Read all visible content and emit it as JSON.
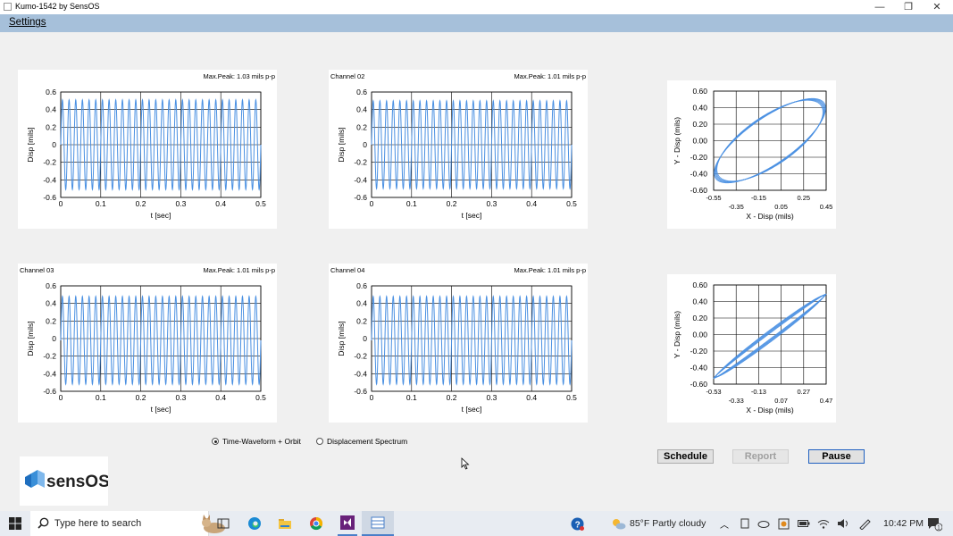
{
  "window": {
    "title": "Kumo-1542 by SensOS",
    "minimize": "—",
    "restore": "❐",
    "close": "✕"
  },
  "menu": {
    "settings": "Settings"
  },
  "charts": {
    "ch1": {
      "label": "",
      "peak": "Max.Peak: 1.03 mils p-p"
    },
    "ch2": {
      "label": "Channel 02",
      "peak": "Max.Peak: 1.01 mils p-p"
    },
    "ch3": {
      "label": "Channel 03",
      "peak": "Max.Peak: 1.01 mils p-p"
    },
    "ch4": {
      "label": "Channel 04",
      "peak": "Max.Peak: 1.01 mils p-p"
    }
  },
  "chart_data": [
    {
      "type": "line",
      "id": "ch1",
      "xlabel": "t [sec]",
      "ylabel": "Disp [mils]",
      "xlim": [
        0,
        0.5
      ],
      "ylim": [
        -0.6,
        0.6
      ],
      "xticks": [
        "0",
        "0.1",
        "0.2",
        "0.3",
        "0.4",
        "0.5"
      ],
      "yticks": [
        "0.6",
        "0.4",
        "0.2",
        "0",
        "-0.2",
        "-0.4",
        "-0.6"
      ],
      "grid": true,
      "series": [
        {
          "amplitude": 0.51,
          "offset": 0.0,
          "cycles": 30,
          "color": "#4a90e2"
        }
      ]
    },
    {
      "type": "line",
      "id": "ch2",
      "xlabel": "t [sec]",
      "ylabel": "Disp [mils]",
      "xlim": [
        0,
        0.5
      ],
      "ylim": [
        -0.6,
        0.6
      ],
      "xticks": [
        "0",
        "0.1",
        "0.2",
        "0.3",
        "0.4",
        "0.5"
      ],
      "yticks": [
        "0.6",
        "0.4",
        "0.2",
        "0",
        "-0.2",
        "-0.4",
        "-0.6"
      ],
      "grid": true,
      "series": [
        {
          "amplitude": 0.5,
          "offset": 0.0,
          "cycles": 30,
          "color": "#4a90e2"
        }
      ]
    },
    {
      "type": "line",
      "id": "ch3",
      "xlabel": "t [sec]",
      "ylabel": "Disp [mils]",
      "xlim": [
        0,
        0.5
      ],
      "ylim": [
        -0.6,
        0.6
      ],
      "xticks": [
        "0",
        "0.1",
        "0.2",
        "0.3",
        "0.4",
        "0.5"
      ],
      "yticks": [
        "0.6",
        "0.4",
        "0.2",
        "0",
        "-0.2",
        "-0.4",
        "-0.6"
      ],
      "grid": true,
      "series": [
        {
          "amplitude": 0.5,
          "offset": -0.02,
          "cycles": 30,
          "color": "#4a90e2"
        }
      ]
    },
    {
      "type": "line",
      "id": "ch4",
      "xlabel": "t [sec]",
      "ylabel": "Disp [mils]",
      "xlim": [
        0,
        0.5
      ],
      "ylim": [
        -0.6,
        0.6
      ],
      "xticks": [
        "0",
        "0.1",
        "0.2",
        "0.3",
        "0.4",
        "0.5"
      ],
      "yticks": [
        "0.6",
        "0.4",
        "0.2",
        "0",
        "-0.2",
        "-0.4",
        "-0.6"
      ],
      "grid": true,
      "series": [
        {
          "amplitude": 0.5,
          "offset": -0.02,
          "cycles": 30,
          "color": "#4a90e2"
        }
      ]
    },
    {
      "type": "scatter",
      "id": "orbit1",
      "xlabel": "X - Disp (mils)",
      "ylabel": "Y - Disp (mils)",
      "xlim": [
        -0.55,
        0.45
      ],
      "ylim": [
        -0.6,
        0.6
      ],
      "xticks_upper": [
        "-0.55",
        "-0.15",
        "0.25"
      ],
      "xticks_lower": [
        "-0.35",
        "0.05",
        "0.45"
      ],
      "yticks": [
        "0.60",
        "0.40",
        "0.20",
        "0.00",
        "-0.20",
        "-0.40",
        "-0.60"
      ],
      "grid": true,
      "orbit": {
        "center": [
          -0.05,
          0.0
        ],
        "rx": 0.495,
        "ry": 0.51,
        "phase_deg": 40,
        "traces": 5
      }
    },
    {
      "type": "scatter",
      "id": "orbit2",
      "xlabel": "X - Disp (mils)",
      "ylabel": "Y - Disp (mils)",
      "xlim": [
        -0.53,
        0.47
      ],
      "ylim": [
        -0.6,
        0.6
      ],
      "xticks_upper": [
        "-0.53",
        "-0.13",
        "0.27"
      ],
      "xticks_lower": [
        "-0.33",
        "0.07",
        "0.47"
      ],
      "yticks": [
        "0.60",
        "0.40",
        "0.20",
        "0.00",
        "-0.20",
        "-0.40",
        "-0.60"
      ],
      "grid": true,
      "orbit": {
        "center": [
          -0.03,
          -0.02
        ],
        "rx": 0.5,
        "ry": 0.51,
        "phase_deg": 4,
        "traces": 5
      }
    }
  ],
  "modes": {
    "option1": "Time-Waveform + Orbit",
    "option2": "Displacement Spectrum",
    "selected": "option1"
  },
  "buttons": {
    "schedule": "Schedule",
    "report": "Report",
    "pause": "Pause"
  },
  "logo": {
    "text": "sensOS"
  },
  "taskbar": {
    "search_placeholder": "Type here to search",
    "weather": "85°F  Partly cloudy",
    "time": "10:42 PM",
    "notif_count": "1"
  },
  "colors": {
    "menubar": "#a6c0da",
    "trace": "#4a90e2",
    "logo_accent": "#3a8fd8"
  }
}
